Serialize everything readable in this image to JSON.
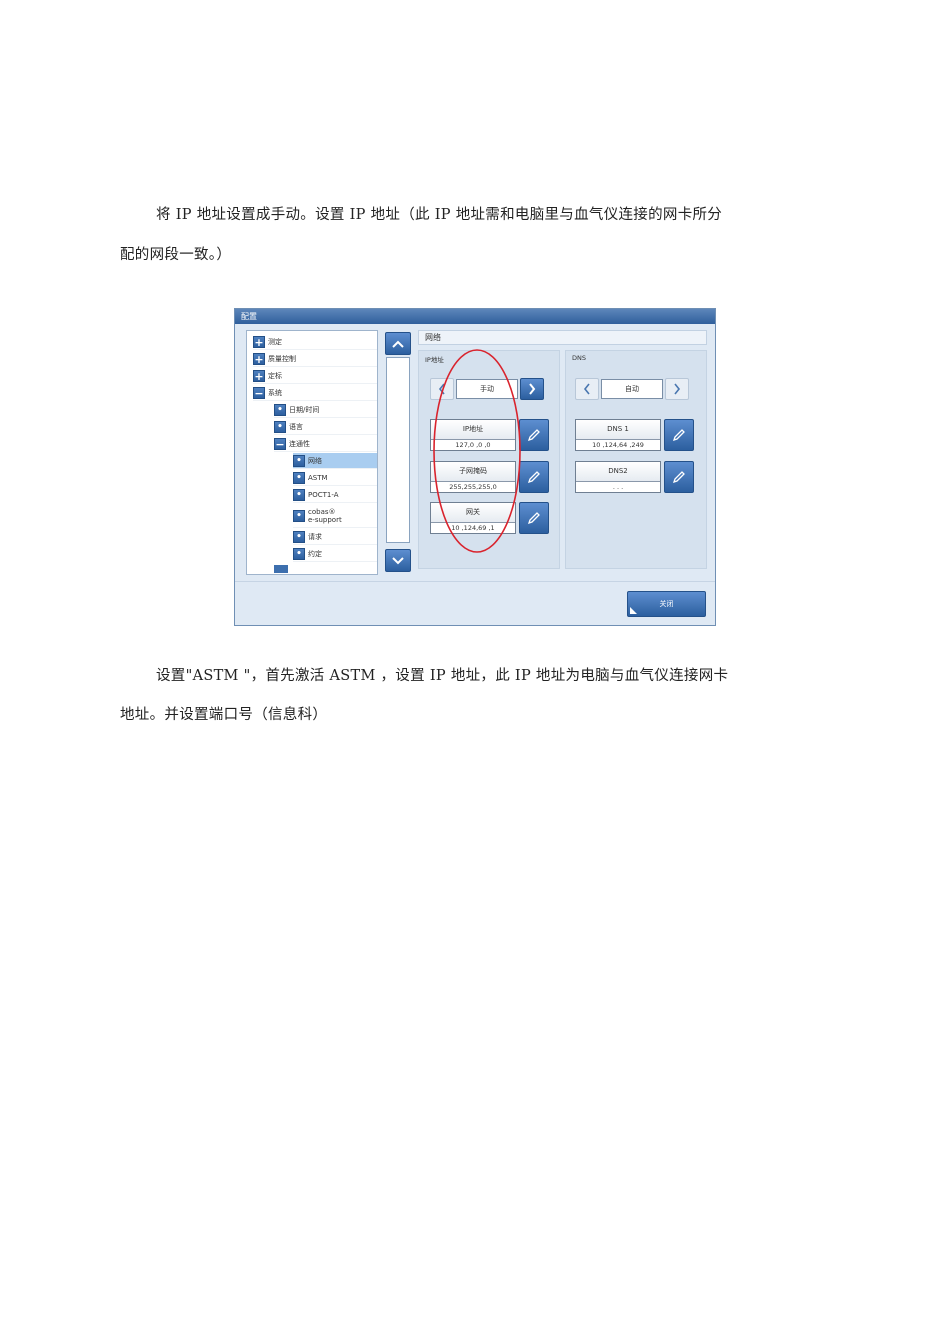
{
  "doc": {
    "para1_line1": "将 IP 地址设置成手动。设置 IP 地址（此 IP 地址需和电脑里与血气仪连接的网卡所分",
    "para1_line2": "配的网段一致。）",
    "para2_line1": "设置\"ASTM \"，首先激活 ASTM ，设置 IP 地址，此 IP 地址为电脑与血气仪连接网卡",
    "para2_line2": "地址。并设置端口号（信息科）"
  },
  "screenshot": {
    "window_title": "配置",
    "tree": [
      {
        "label": "测定",
        "box": "+"
      },
      {
        "label": "质量控制",
        "box": "+"
      },
      {
        "label": "定标",
        "box": "+"
      },
      {
        "label": "系统",
        "box": "−"
      },
      {
        "label": "日期/时间",
        "box": "•"
      },
      {
        "label": "语言",
        "box": "•"
      },
      {
        "label": "连通性",
        "box": "−"
      },
      {
        "label": "网络",
        "box": "•",
        "selected": true
      },
      {
        "label": "ASTM",
        "box": "•"
      },
      {
        "label": "POCT1-A",
        "box": "•"
      },
      {
        "label": "cobas®\ne-support",
        "box": "•"
      },
      {
        "label": "请求",
        "box": "•"
      },
      {
        "label": "约定",
        "box": "•"
      }
    ],
    "panel_title": "网络",
    "ip_group": {
      "label": "IP地址",
      "mode": "手动",
      "fields": [
        {
          "label": "IP地址",
          "value": "127,0 ,0 ,0"
        },
        {
          "label": "子网掩码",
          "value": "255,255,255,0"
        },
        {
          "label": "网关",
          "value": "10 ,124,69 ,1"
        }
      ]
    },
    "dns_group": {
      "label": "DNS",
      "mode": "自动",
      "fields": [
        {
          "label": "DNS 1",
          "value": "10 ,124,64 ,249"
        },
        {
          "label": "DNS2",
          "value": ". . ."
        }
      ]
    },
    "close_label": "关闭",
    "colors": {
      "accent": "#2c5f9f",
      "highlight": "#d9232d"
    }
  }
}
